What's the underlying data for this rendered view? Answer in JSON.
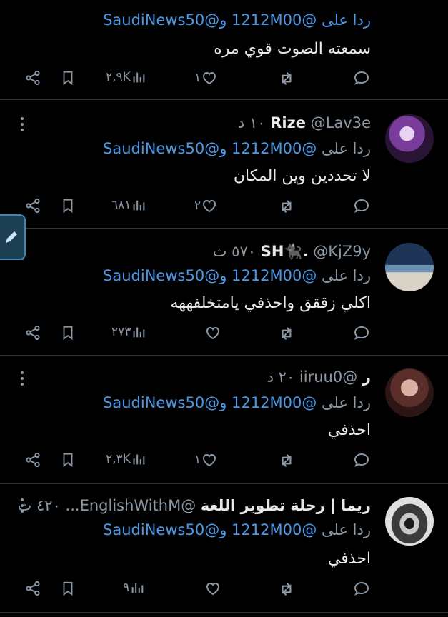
{
  "colors": {
    "background": "#000000",
    "mention": "#4a99e9",
    "muted": "#8b98a5",
    "text": "#e7e9ea",
    "divider": "#2f3336"
  },
  "top": {
    "reply_line": "ردا على @1212M00 و@SaudiNews50",
    "text": "سمعته الصوت قوي مره",
    "views": "٢,٩K",
    "likes": "١"
  },
  "tweets": [
    {
      "name": "Rize",
      "handle": "@Lav3e",
      "time": "١٠ د",
      "reply_prefix": "ردا على",
      "mentions": "@1212M00 و@SaudiNews50",
      "text": "لا تحددين وين المكان",
      "views": "٦٨١",
      "likes": "٢",
      "avatar_icon": "avatar-purple-hair"
    },
    {
      "name": "SH🐈‍⬛.",
      "handle": "@KjZ9y",
      "time": "٥٧٠ ث",
      "reply_prefix": "ردا على",
      "mentions": "@1212M00 و@SaudiNews50",
      "text": "اكلي زققق واحذفي يامتخلفههه",
      "views": "٢٧٣",
      "likes": "",
      "avatar_icon": "avatar-sea"
    },
    {
      "name": "ر",
      "handle": "@iiruu0",
      "time": "٢٠ د",
      "reply_prefix": "ردا على",
      "mentions": "@1212M00 و@SaudiNews50",
      "text": "احذفي",
      "views": "٢,٣K",
      "likes": "١",
      "avatar_icon": "avatar-girl"
    },
    {
      "name": "ريما | رحلة تطوير اللغة",
      "handle": "@EnglishWithM...",
      "time": "٤٢٠ ث",
      "reply_prefix": "ردا على",
      "mentions": "@1212M00 و@SaudiNews50",
      "text": "احذفي",
      "views": "٩",
      "likes": "",
      "avatar_icon": "avatar-eye"
    }
  ]
}
